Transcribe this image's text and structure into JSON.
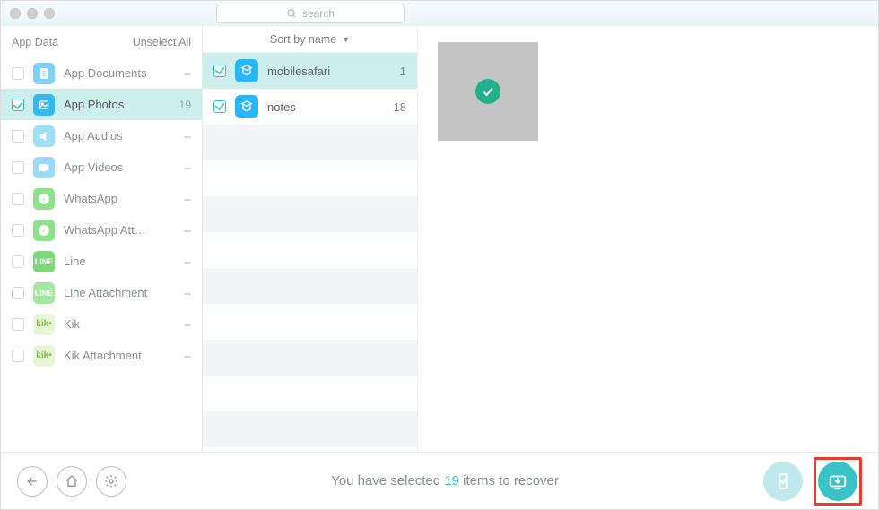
{
  "search": {
    "placeholder": "search"
  },
  "sidebar": {
    "header_label": "App Data",
    "unselect_label": "Unselect All",
    "items": [
      {
        "label": "App Documents",
        "count": "--",
        "checked": false,
        "active": false,
        "icon": "doc",
        "color": "#7fd0f7"
      },
      {
        "label": "App Photos",
        "count": "19",
        "checked": true,
        "active": true,
        "icon": "photo",
        "color": "#35b8f1"
      },
      {
        "label": "App Audios",
        "count": "--",
        "checked": false,
        "active": false,
        "icon": "audio",
        "color": "#9ddff3"
      },
      {
        "label": "App Videos",
        "count": "--",
        "checked": false,
        "active": false,
        "icon": "video",
        "color": "#9cd9f7"
      },
      {
        "label": "WhatsApp",
        "count": "--",
        "checked": false,
        "active": false,
        "icon": "wa",
        "color": "#8fe28b"
      },
      {
        "label": "WhatsApp Att…",
        "count": "--",
        "checked": false,
        "active": false,
        "icon": "wa",
        "color": "#8fe28b"
      },
      {
        "label": "Line",
        "count": "--",
        "checked": false,
        "active": false,
        "icon": "line",
        "color": "#7ed779"
      },
      {
        "label": "Line Attachment",
        "count": "--",
        "checked": false,
        "active": false,
        "icon": "line",
        "color": "#a6e6a2"
      },
      {
        "label": "Kik",
        "count": "--",
        "checked": false,
        "active": false,
        "icon": "kik",
        "color": "#e8f6d8"
      },
      {
        "label": "Kik Attachment",
        "count": "--",
        "checked": false,
        "active": false,
        "icon": "kik",
        "color": "#e8f6d8"
      }
    ]
  },
  "sort_label": "Sort by name",
  "items": [
    {
      "label": "mobilesafari",
      "count": "1",
      "checked": true
    },
    {
      "label": "notes",
      "count": "18",
      "checked": true
    }
  ],
  "footer": {
    "prefix": "You have selected ",
    "count": "19",
    "suffix": " items to recover"
  }
}
